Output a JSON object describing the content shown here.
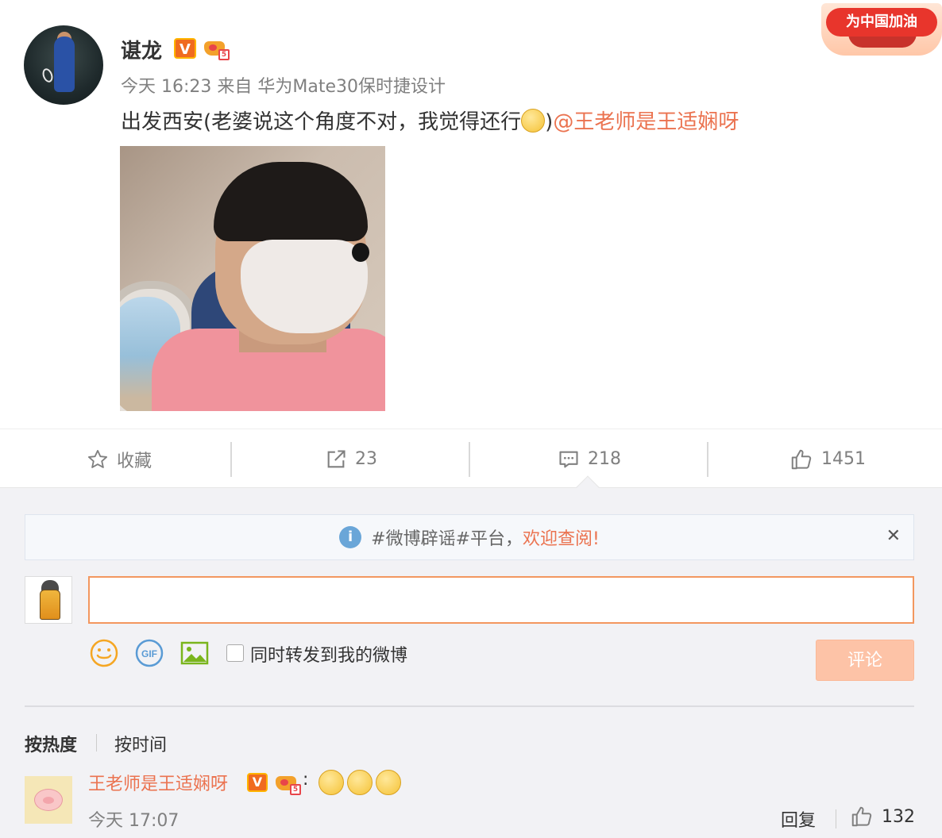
{
  "post": {
    "username": "谌龙",
    "verified_badge": "V",
    "member_level": "5",
    "meta": "今天 16:23 来自 华为Mate30保时捷设计",
    "content_text": "出发西安(老婆说这个角度不对，我觉得还行",
    "content_close": ")",
    "mention": "@王老师是王适娴呀"
  },
  "banner": {
    "text": "为中国加油"
  },
  "actions": {
    "favorite": "收藏",
    "repost_count": "23",
    "comment_count": "218",
    "like_count": "1451"
  },
  "notice": {
    "info_glyph": "i",
    "text": "#微博辟谣#平台，",
    "highlight": "欢迎查阅!",
    "close": "✕"
  },
  "composer": {
    "repost_label": "同时转发到我的微博",
    "submit": "评论"
  },
  "sort": {
    "hot": "按热度",
    "time": "按时间"
  },
  "comment": {
    "username": "王老师是王适娴呀",
    "verified_badge": "V",
    "member_level": "5",
    "colon": ":",
    "time": "今天 17:07",
    "reply": "回复",
    "likes": "132"
  },
  "colors": {
    "accent": "#eb7350",
    "muted": "#808080",
    "submit_disabled": "#fdc3a7"
  }
}
